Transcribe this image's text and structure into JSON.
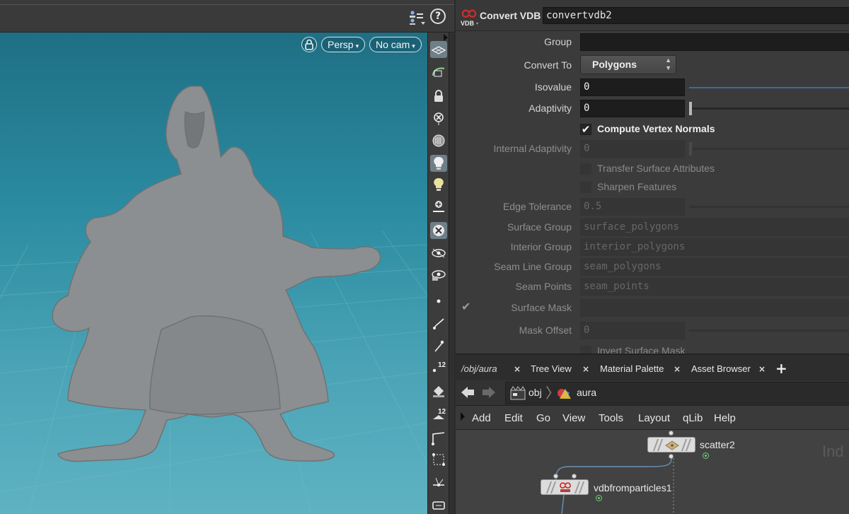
{
  "viewport": {
    "lock_icon": "lock-icon",
    "persp_label": "Persp",
    "camera_label": "No cam",
    "dropdown_caret": "▾",
    "help_glyph": "?"
  },
  "toolbar_icons": [
    "grid-display-icon",
    "snap-icon",
    "lock-camera-icon",
    "close-handle-icon",
    "display-mode-icon",
    "lighting-icon",
    "headlight-icon",
    "light-link-icon",
    "shading-sphere-icon",
    "template-icon",
    "ghost-icon",
    "point-icon",
    "brush-icon",
    "pen-icon",
    "point-numbers-icon",
    "fill-icon",
    "primitive-numbers-icon",
    "curve-icon",
    "vertex-icon",
    "normals-icon",
    "misc-icon"
  ],
  "node_header": {
    "badge_text": "VDB",
    "type_label": "Convert VDB",
    "name_value": "convertvdb2"
  },
  "params": {
    "group": {
      "label": "Group",
      "value": ""
    },
    "convert_to": {
      "label": "Convert To",
      "value": "Polygons"
    },
    "isovalue": {
      "label": "Isovalue",
      "value": "0"
    },
    "adaptivity": {
      "label": "Adaptivity",
      "value": "0"
    },
    "compute_normals": {
      "label": "Compute Vertex Normals",
      "check": "✔"
    },
    "internal_adaptivity": {
      "label": "Internal Adaptivity",
      "value": "0"
    },
    "transfer_attrs": {
      "label": "Transfer Surface Attributes"
    },
    "sharpen": {
      "label": "Sharpen Features"
    },
    "edge_tolerance": {
      "label": "Edge Tolerance",
      "value": "0.5"
    },
    "surface_group": {
      "label": "Surface Group",
      "value": "surface_polygons"
    },
    "interior_group": {
      "label": "Interior Group",
      "value": "interior_polygons"
    },
    "seam_line_group": {
      "label": "Seam Line Group",
      "value": "seam_polygons"
    },
    "seam_points": {
      "label": "Seam Points",
      "value": "seam_points"
    },
    "surface_mask": {
      "label": "Surface Mask",
      "value": "",
      "check": "✔"
    },
    "mask_offset": {
      "label": "Mask Offset",
      "value": "0"
    },
    "invert_mask": {
      "label": "Invert Surface Mask"
    }
  },
  "tabs": [
    {
      "label": "/obj/aura",
      "close": "×"
    },
    {
      "label": "Tree View",
      "close": "×"
    },
    {
      "label": "Material Palette",
      "close": "×"
    },
    {
      "label": "Asset Browser",
      "close": "×"
    }
  ],
  "add_tab_glyph": "+",
  "path": {
    "obj_label": "obj",
    "geo_label": "aura"
  },
  "net_menu": [
    "Add",
    "Edit",
    "Go",
    "View",
    "Tools",
    "Layout",
    "qLib",
    "Help"
  ],
  "network": {
    "bg_text": "Ind",
    "nodes": [
      {
        "name": "scatter2"
      },
      {
        "name": "vdbfromparticles1"
      }
    ]
  },
  "colors": {
    "accent_blue": "#2d6fae",
    "vdb_red": "#d42b2b",
    "display_flag": "#6fcf6f"
  }
}
